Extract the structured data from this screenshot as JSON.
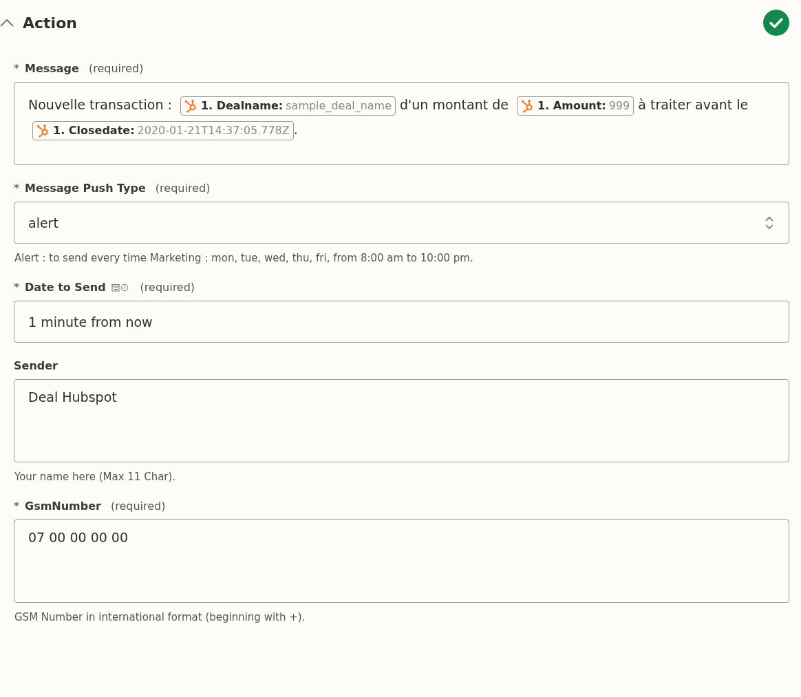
{
  "section": {
    "title": "Action",
    "expanded": true,
    "complete": true
  },
  "fields": [
    {
      "kind": "rich",
      "marker": "*",
      "label": "Message",
      "required_note": "(required)",
      "parts": [
        {
          "kind": "text",
          "text": "Nouvelle transaction :"
        },
        {
          "kind": "token",
          "label": "1. Dealname:",
          "value": "sample_deal_name"
        },
        {
          "kind": "text",
          "text": "d'un montant de"
        },
        {
          "kind": "token",
          "label": "1. Amount:",
          "value": "999"
        },
        {
          "kind": "text",
          "text": "à traiter avant le"
        },
        {
          "kind": "token",
          "label": "1. Closedate:",
          "value": "2020-01-21T14:37:05.778Z"
        },
        {
          "kind": "punct",
          "text": "."
        }
      ]
    },
    {
      "kind": "select",
      "marker": "*",
      "label": "Message Push Type",
      "required_note": "(required)",
      "value": "alert",
      "hint": "Alert : to send every time Marketing : mon, tue, wed, thu, fri, from 8:00 am to 10:00 pm."
    },
    {
      "kind": "input",
      "marker": "*",
      "label": "Date to Send",
      "datetime": true,
      "required_note": "(required)",
      "value": "1 minute from now"
    },
    {
      "kind": "textarea",
      "label": "Sender",
      "value": "Deal Hubspot",
      "hint": "Your name here (Max 11 Char)."
    },
    {
      "kind": "textarea",
      "marker": "*",
      "label": "GsmNumber",
      "required_note": "(required)",
      "value": "07 00 00 00 00",
      "hint": "GSM Number in international format (beginning with +)."
    }
  ]
}
